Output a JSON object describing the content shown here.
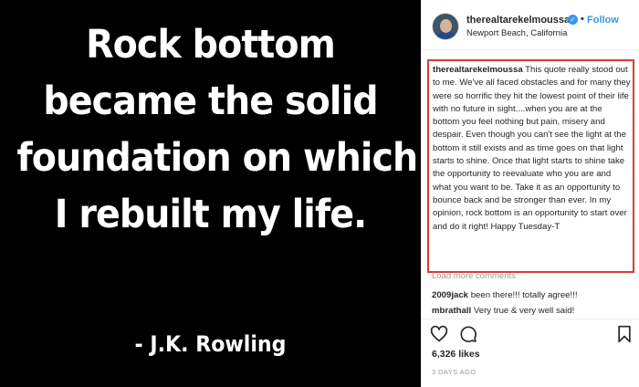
{
  "image": {
    "quote_lines": [
      "Rock bottom",
      "became the solid",
      "foundation on which",
      "I rebuilt my life."
    ],
    "attribution": "- J.K. Rowling"
  },
  "header": {
    "username": "therealtarekelmoussa",
    "dot": "•",
    "follow_label": "Follow",
    "location": "Newport Beach, California"
  },
  "caption": {
    "username": "therealtarekelmoussa",
    "text": "This quote really stood out to me. We've all faced obstacles and for many they were so horrific they hit the lowest point of their life with no future in sight....when you are at the bottom you feel nothing but pain, misery and despair. Even though you can't see the light at the bottom it still exists and as time goes on that light starts to shine. Once that light starts to shine take the opportunity to reevaluate who you are and what you want to be. Take it as an opportunity to bounce back and be stronger than ever. In my opinion, rock bottom is an opportunity to start over and do it right! Happy Tuesday-T"
  },
  "load_more": "Load more comments",
  "comments": [
    {
      "user": "2009jack",
      "text": "been there!!! totally agree!!!"
    },
    {
      "user": "mbrathall",
      "text": "Very true & very well said!"
    }
  ],
  "likes": "6,326 likes",
  "timestamp": "3 DAYS AGO",
  "icons": {
    "verified": "verified-badge-icon",
    "like": "heart-icon",
    "comment": "comment-icon",
    "save": "bookmark-icon"
  },
  "colors": {
    "accent": "#3897f0",
    "highlight_border": "#d73a3a",
    "image_background": "#000000"
  }
}
